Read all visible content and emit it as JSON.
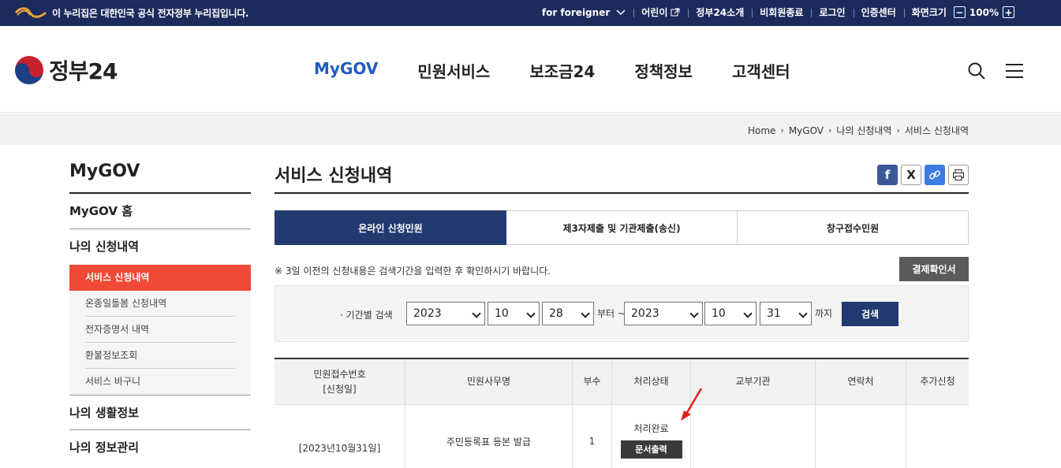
{
  "topbar": {
    "gov_notice": "이 누리집은 대한민국 공식 전자정부 누리집입니다.",
    "foreigner": "for foreigner",
    "kids": "어린이",
    "about": "정부24소개",
    "guest_end": "비회원종료",
    "login": "로그인",
    "cert_center": "인증센터",
    "zoom_label": "화면크기",
    "zoom_minus": "−",
    "zoom_value": "100%",
    "zoom_plus": "+"
  },
  "header": {
    "logo_text": "정부24",
    "nav": [
      "MyGOV",
      "민원서비스",
      "보조금24",
      "정책정보",
      "고객센터"
    ],
    "active_nav": "MyGOV"
  },
  "breadcrumb": [
    "Home",
    "MyGOV",
    "나의 신청내역",
    "서비스 신청내역"
  ],
  "sidebar": {
    "title": "MyGOV",
    "home": "MyGOV 홈",
    "section_apply": "나의 신청내역",
    "items": [
      "서비스 신청내역",
      "온종일돌봄 신청내역",
      "전자증명서 내역",
      "환불정보조회",
      "서비스 바구니"
    ],
    "active_item": "서비스 신청내역",
    "section_life": "나의 생활정보",
    "section_info": "나의 정보관리"
  },
  "main": {
    "title": "서비스 신청내역",
    "share": {
      "facebook": "f",
      "x": "X"
    },
    "tabs": [
      "온라인 신청민원",
      "제3자제출 및 기관제출(송신)",
      "창구접수민원"
    ],
    "active_tab": "온라인 신청민원",
    "notice": "※ 3일 이전의 신청내용은 검색기간을 입력한 후 확인하시기 바랍니다.",
    "result_cert_button": "결제확인서",
    "search": {
      "label": "· 기간별 검색",
      "from_year": "2023",
      "from_month": "10",
      "from_day": "28",
      "from_suffix": "부터 ~",
      "to_year": "2023",
      "to_month": "10",
      "to_day": "31",
      "to_suffix": "까지",
      "button": "검색"
    },
    "table": {
      "headers": [
        "민원접수번호\n[신청일]",
        "민원사무명",
        "부수",
        "처리상태",
        "교부기관",
        "연락처",
        "추가신청"
      ],
      "rows": [
        {
          "date": "[2023년10월31일]",
          "name": "주민등록표 등본 발급",
          "count": "1",
          "status": "처리완료",
          "print_button": "문서출력",
          "agency": "",
          "contact": "",
          "extra": ""
        }
      ]
    }
  },
  "colors": {
    "topbar": "#1c2b5c",
    "active_nav": "#1f5dc0",
    "sidebar_active": "#f04a36",
    "tab_active": "#233a70",
    "arrow": "#e31d1d"
  }
}
